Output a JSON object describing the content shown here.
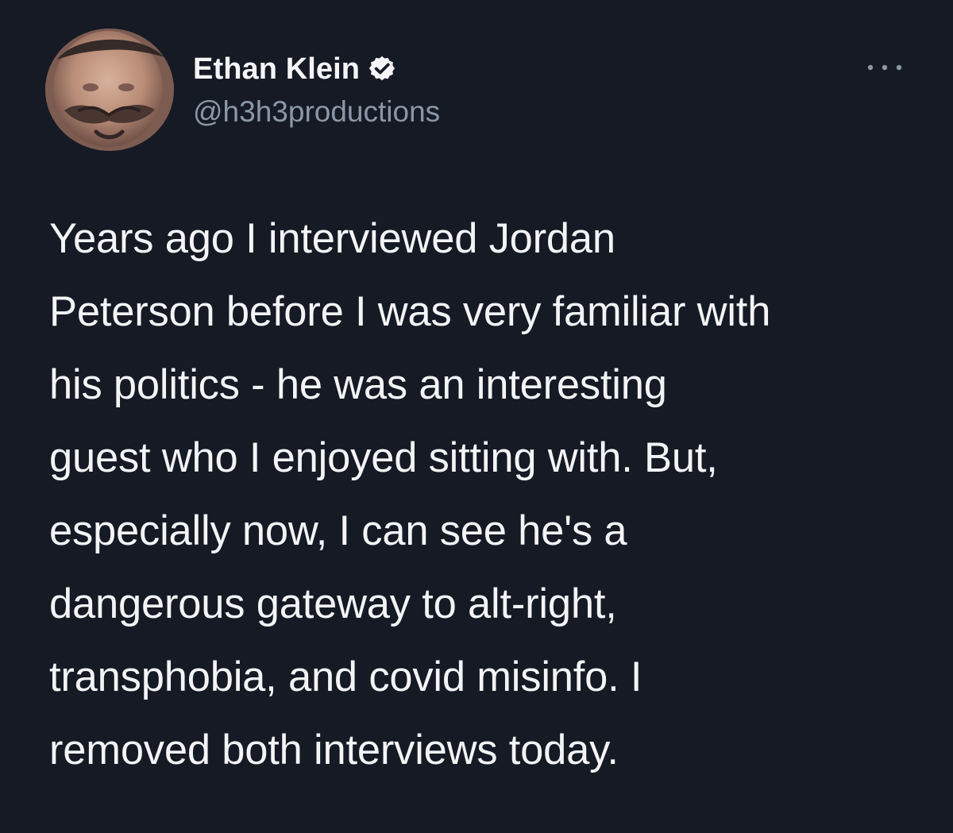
{
  "author": {
    "display_name": "Ethan Klein",
    "handle": "@h3h3productions",
    "verified": true,
    "avatar_icon": "profile-photo"
  },
  "tweet": {
    "lines": [
      "Years ago I interviewed Jordan",
      "Peterson before I was very familiar with",
      "his politics - he was an interesting",
      "guest who I enjoyed sitting with. But,",
      "especially now, I can see he's a",
      "dangerous gateway to alt-right,",
      "transphobia, and covid misinfo. I",
      "removed both interviews today."
    ]
  },
  "icons": {
    "verified": "verified-badge-icon",
    "more": "more-options-icon"
  },
  "colors": {
    "background": "#151a24",
    "primary_text": "#f3f4f6",
    "secondary_text": "#8b97a6"
  }
}
